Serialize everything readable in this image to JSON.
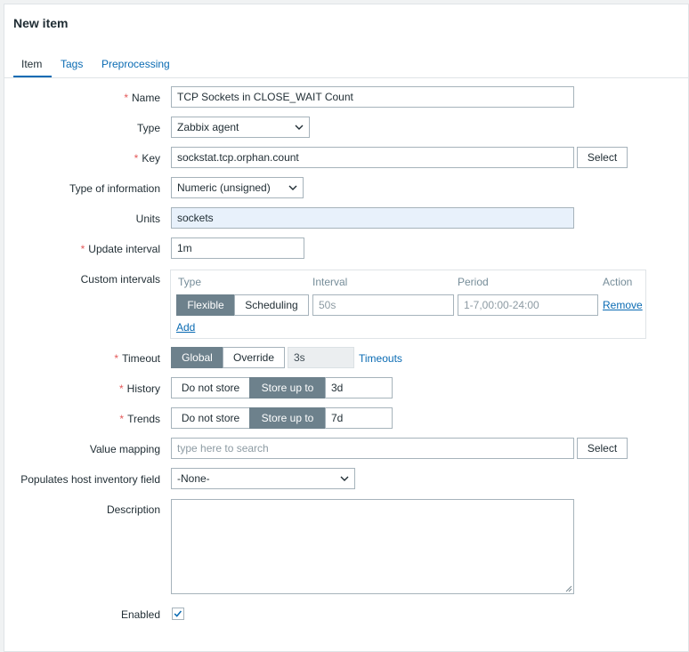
{
  "dialog": {
    "title": "New item"
  },
  "tabs": [
    {
      "label": "Item",
      "active": true
    },
    {
      "label": "Tags",
      "active": false
    },
    {
      "label": "Preprocessing",
      "active": false
    }
  ],
  "form": {
    "name": {
      "label": "Name",
      "required": true,
      "value": "TCP Sockets in CLOSE_WAIT Count"
    },
    "type": {
      "label": "Type",
      "value": "Zabbix agent"
    },
    "key": {
      "label": "Key",
      "required": true,
      "value": "sockstat.tcp.orphan.count",
      "select_label": "Select"
    },
    "type_of_information": {
      "label": "Type of information",
      "value": "Numeric (unsigned)"
    },
    "units": {
      "label": "Units",
      "value": "sockets"
    },
    "update_interval": {
      "label": "Update interval",
      "required": true,
      "value": "1m"
    },
    "custom_intervals": {
      "label": "Custom intervals",
      "headers": {
        "type": "Type",
        "interval": "Interval",
        "period": "Period",
        "action": "Action"
      },
      "type_options": [
        "Flexible",
        "Scheduling"
      ],
      "selected_type": "Flexible",
      "interval_placeholder": "50s",
      "period_placeholder": "1-7,00:00-24:00",
      "remove_label": "Remove",
      "add_label": "Add"
    },
    "timeout": {
      "label": "Timeout",
      "required": true,
      "options": [
        "Global",
        "Override"
      ],
      "selected": "Global",
      "value": "3s",
      "link_label": "Timeouts"
    },
    "history": {
      "label": "History",
      "required": true,
      "options": [
        "Do not store",
        "Store up to"
      ],
      "selected": "Store up to",
      "value": "3d"
    },
    "trends": {
      "label": "Trends",
      "required": true,
      "options": [
        "Do not store",
        "Store up to"
      ],
      "selected": "Store up to",
      "value": "7d"
    },
    "value_mapping": {
      "label": "Value mapping",
      "placeholder": "type here to search",
      "select_label": "Select"
    },
    "inventory_field": {
      "label": "Populates host inventory field",
      "value": "-None-"
    },
    "description": {
      "label": "Description",
      "value": ""
    },
    "enabled": {
      "label": "Enabled",
      "checked": true
    }
  },
  "colors": {
    "accent": "#0a6bb3",
    "required": "#e45959",
    "segment_on": "#6d818c"
  }
}
